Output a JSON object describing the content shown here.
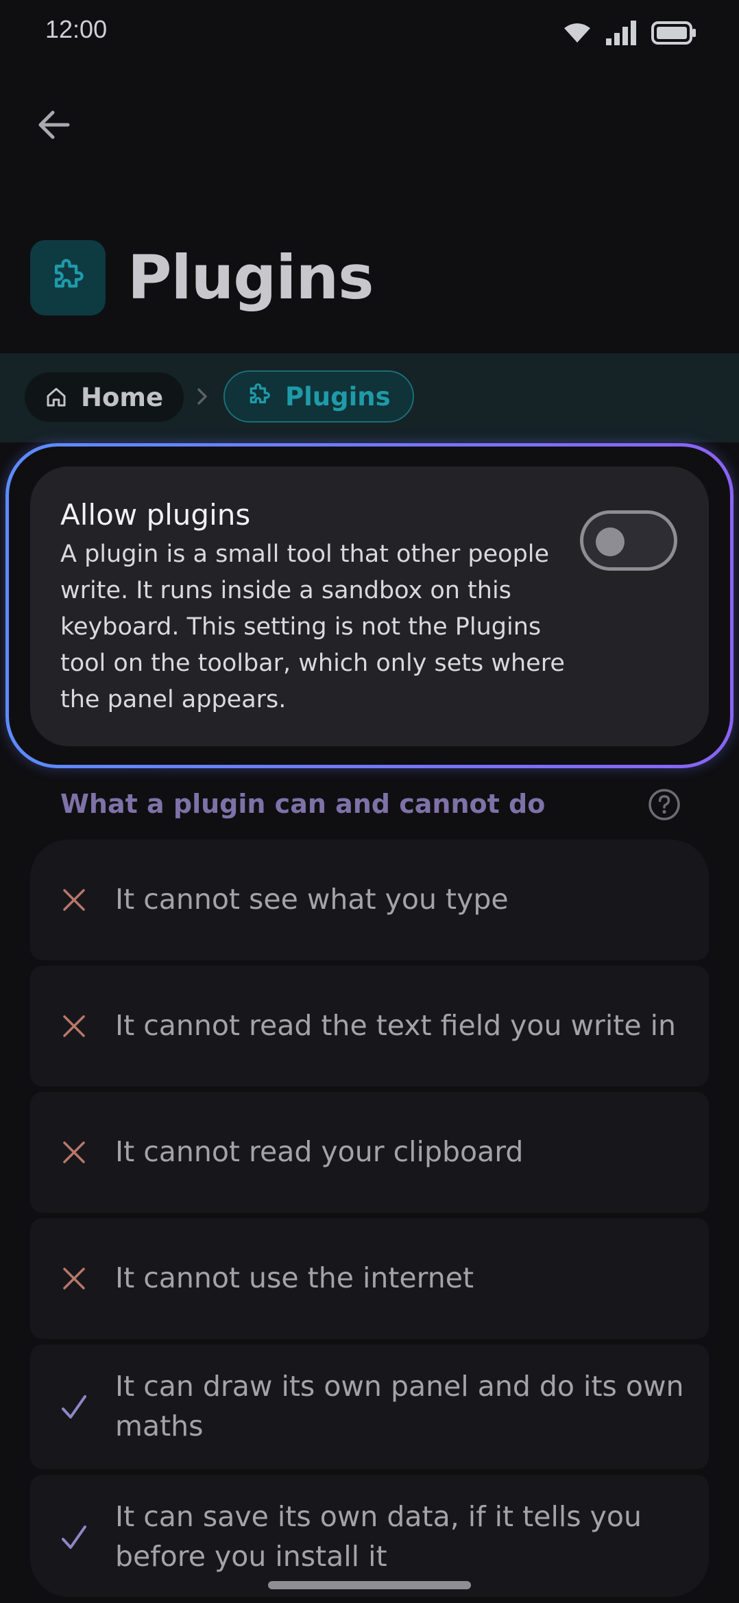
{
  "status_bar": {
    "time": "12:00",
    "icons": [
      "wifi-icon",
      "signal-icon",
      "battery-icon"
    ]
  },
  "header": {
    "back_icon": "arrow-left-icon",
    "title": "Plugins",
    "title_icon": "puzzle-icon"
  },
  "breadcrumb": {
    "home_label": "Home",
    "home_icon": "home-icon",
    "separator_icon": "chevron-right-icon",
    "current_label": "Plugins",
    "current_icon": "puzzle-icon"
  },
  "allow_setting": {
    "title": "Allow plugins",
    "description": "A plugin is a small tool that other people write. It runs inside a sandbox on this keyboard. This setting is not the Plugins tool on the toolbar, which only sets where the panel appears.",
    "enabled": false
  },
  "capabilities": {
    "heading": "What a plugin can and cannot do",
    "help_icon": "help-circle-icon",
    "items": [
      {
        "allowed": false,
        "text": "It cannot see what you type"
      },
      {
        "allowed": false,
        "text": "It cannot read the text field you write in"
      },
      {
        "allowed": false,
        "text": "It cannot read your clipboard"
      },
      {
        "allowed": false,
        "text": "It cannot use the internet"
      },
      {
        "allowed": true,
        "text": "It can draw its own panel and do its own maths"
      },
      {
        "allowed": true,
        "text": "It can save its own data, if it tells you before you install it"
      }
    ]
  },
  "colors": {
    "accent_teal": "#1f9aa9",
    "deny_icon": "#b9776a",
    "allow_icon": "#8f86c7",
    "highlight_gradient_start": "#5b8cff",
    "highlight_gradient_end": "#8a63f5"
  }
}
